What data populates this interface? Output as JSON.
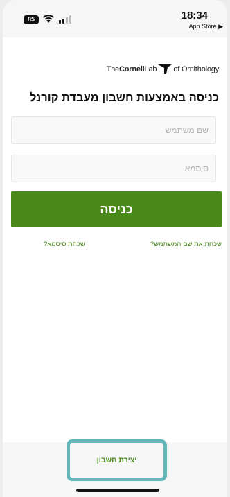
{
  "status_bar": {
    "battery": "85",
    "time": "18:34",
    "back_app": "App Store ▶"
  },
  "logo": {
    "prefix": "The",
    "bold": "Cornell",
    "lab": "Lab",
    "suffix": "of Ornithology"
  },
  "login": {
    "title": "כניסה באמצעות חשבון מעבדת קורנל",
    "username_placeholder": "שם משתמש",
    "password_placeholder": "סיסמא",
    "login_button": "כניסה",
    "forgot_username": "שכחת את שם המשתמש?",
    "forgot_password": "שכחת סיסמא?"
  },
  "footer": {
    "create_account": "יצירת חשבון"
  },
  "colors": {
    "accent_green": "#4a8a1a",
    "highlight_teal": "#62b8b8"
  }
}
